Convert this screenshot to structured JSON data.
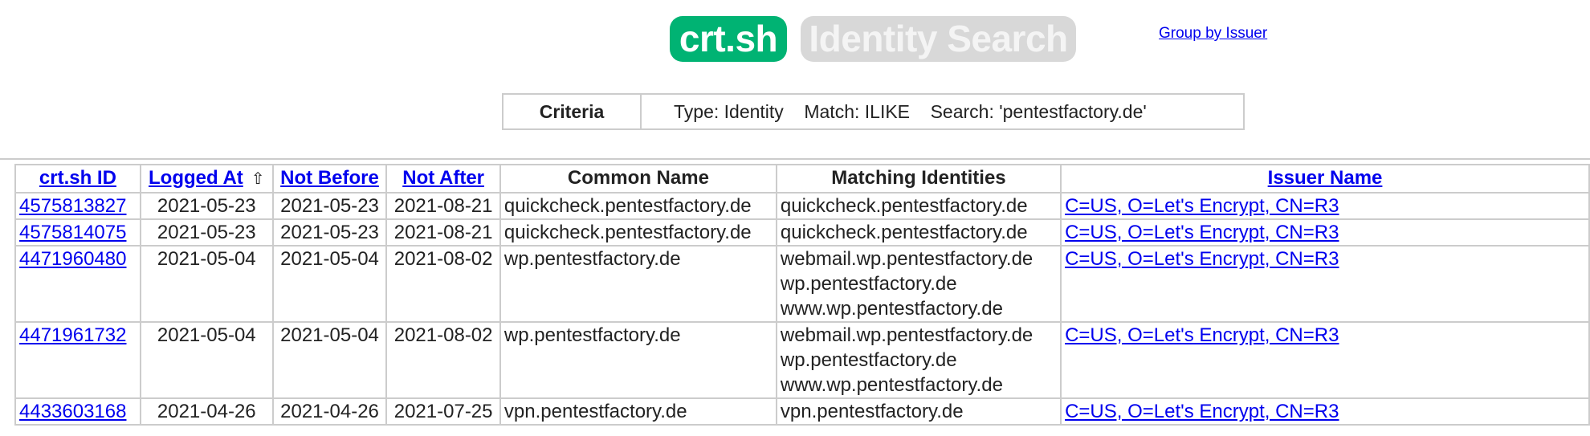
{
  "header": {
    "logo_text": "crt.sh",
    "title": "Identity Search",
    "group_link": "Group by Issuer",
    "brand_color": "#00b373"
  },
  "criteria": {
    "label": "Criteria",
    "value": "Type: Identity    Match: ILIKE    Search: 'pentestfactory.de'"
  },
  "table": {
    "columns": [
      {
        "label": "crt.sh ID",
        "link": true
      },
      {
        "label": "Logged At",
        "link": true,
        "sort": "⇧"
      },
      {
        "label": "Not Before",
        "link": true
      },
      {
        "label": "Not After",
        "link": true
      },
      {
        "label": "Common Name",
        "link": false
      },
      {
        "label": "Matching Identities",
        "link": false
      },
      {
        "label": "Issuer Name",
        "link": true
      }
    ],
    "rows": [
      {
        "id": "4575813827",
        "logged_at": "2021-05-23",
        "not_before": "2021-05-23",
        "not_after": "2021-08-21",
        "common_name": "quickcheck.pentestfactory.de",
        "identities": [
          "quickcheck.pentestfactory.de"
        ],
        "issuer": "C=US, O=Let's Encrypt, CN=R3"
      },
      {
        "id": "4575814075",
        "logged_at": "2021-05-23",
        "not_before": "2021-05-23",
        "not_after": "2021-08-21",
        "common_name": "quickcheck.pentestfactory.de",
        "identities": [
          "quickcheck.pentestfactory.de"
        ],
        "issuer": "C=US, O=Let's Encrypt, CN=R3"
      },
      {
        "id": "4471960480",
        "logged_at": "2021-05-04",
        "not_before": "2021-05-04",
        "not_after": "2021-08-02",
        "common_name": "wp.pentestfactory.de",
        "identities": [
          "webmail.wp.pentestfactory.de",
          "wp.pentestfactory.de",
          "www.wp.pentestfactory.de"
        ],
        "issuer": "C=US, O=Let's Encrypt, CN=R3"
      },
      {
        "id": "4471961732",
        "logged_at": "2021-05-04",
        "not_before": "2021-05-04",
        "not_after": "2021-08-02",
        "common_name": "wp.pentestfactory.de",
        "identities": [
          "webmail.wp.pentestfactory.de",
          "wp.pentestfactory.de",
          "www.wp.pentestfactory.de"
        ],
        "issuer": "C=US, O=Let's Encrypt, CN=R3"
      },
      {
        "id": "4433603168",
        "logged_at": "2021-04-26",
        "not_before": "2021-04-26",
        "not_after": "2021-07-25",
        "common_name": "vpn.pentestfactory.de",
        "identities": [
          "vpn.pentestfactory.de"
        ],
        "issuer": "C=US, O=Let's Encrypt, CN=R3"
      }
    ]
  }
}
